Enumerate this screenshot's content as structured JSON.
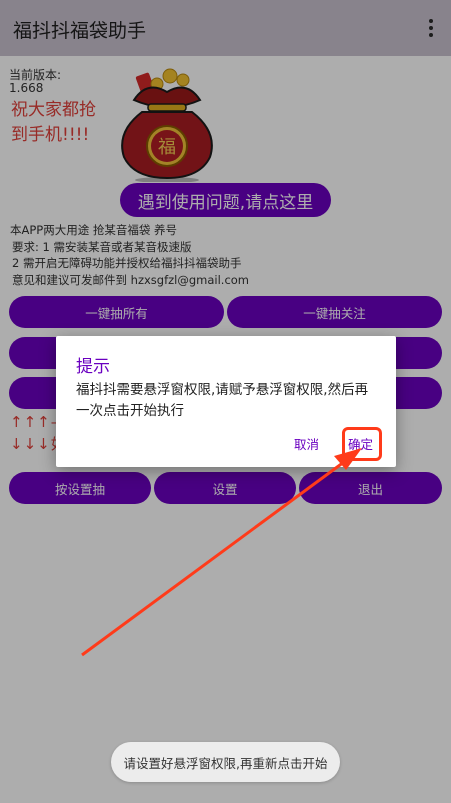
{
  "appbar": {
    "title": "福抖抖福袋助手",
    "menu_icon": "more-vert-icon"
  },
  "version": {
    "label": "当前版本:",
    "value": "1.668"
  },
  "wish": "祝大家都抢到手机!!!!",
  "bag_char": "福",
  "help_button": "遇到使用问题,请点这里",
  "description": [
    "本APP两大用途 抢某音福袋 养号",
    "要求: 1 需安装某音或者某音极速版",
    "2 需开启无障碍功能并授权给福抖抖福袋助手",
    "意见和建议可发邮件到 hzxsgfzl@gmail.com"
  ],
  "buttons": {
    "grab_all": "一键抽所有",
    "grab_follow": "一键抽关注",
    "grab_by_setting": "按设置抽",
    "settings": "设置",
    "exit": "退出"
  },
  "arrows": {
    "up": "↑↑↑—",
    "down": "↓↓↓如"
  },
  "dialog": {
    "title": "提示",
    "message": "福抖抖需要悬浮窗权限,请赋予悬浮窗权限,然后再一次点击开始执行",
    "cancel": "取消",
    "ok": "确定"
  },
  "toast": "请设置好悬浮窗权限,再重新点击开始",
  "colors": {
    "primary": "#6a00c0",
    "accent_red": "#e0403a",
    "annotation": "#ff3b1a"
  }
}
